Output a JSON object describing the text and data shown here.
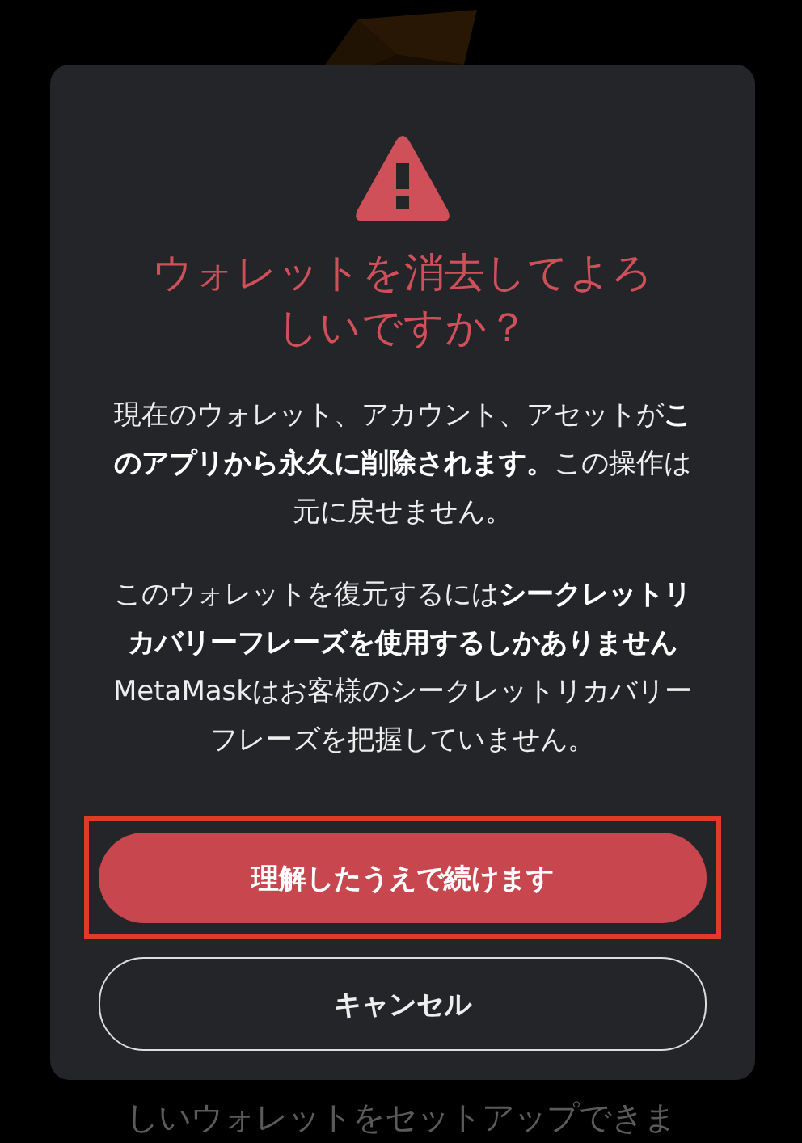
{
  "background": {
    "lines": [
      "しいウォレットをセットアップできま"
    ]
  },
  "dialog": {
    "title": "ウォレットを消去してよろしいですか？",
    "paragraphs": [
      "現在のウォレット、アカウント、アセットが**このアプリから永久に削除されます。**この操作は元に戻せません。",
      "このウォレットを復元するには**シークレットリカバリーフレーズを使用するしかありません**\nMetaMaskはお客様のシークレットリカバリーフレーズを把握していません。"
    ],
    "buttons": [
      {
        "label": "理解したうえで続けます",
        "kind": "primary",
        "highlighted": true
      },
      {
        "label": "キャンセル",
        "kind": "secondary",
        "highlighted": false
      }
    ]
  }
}
